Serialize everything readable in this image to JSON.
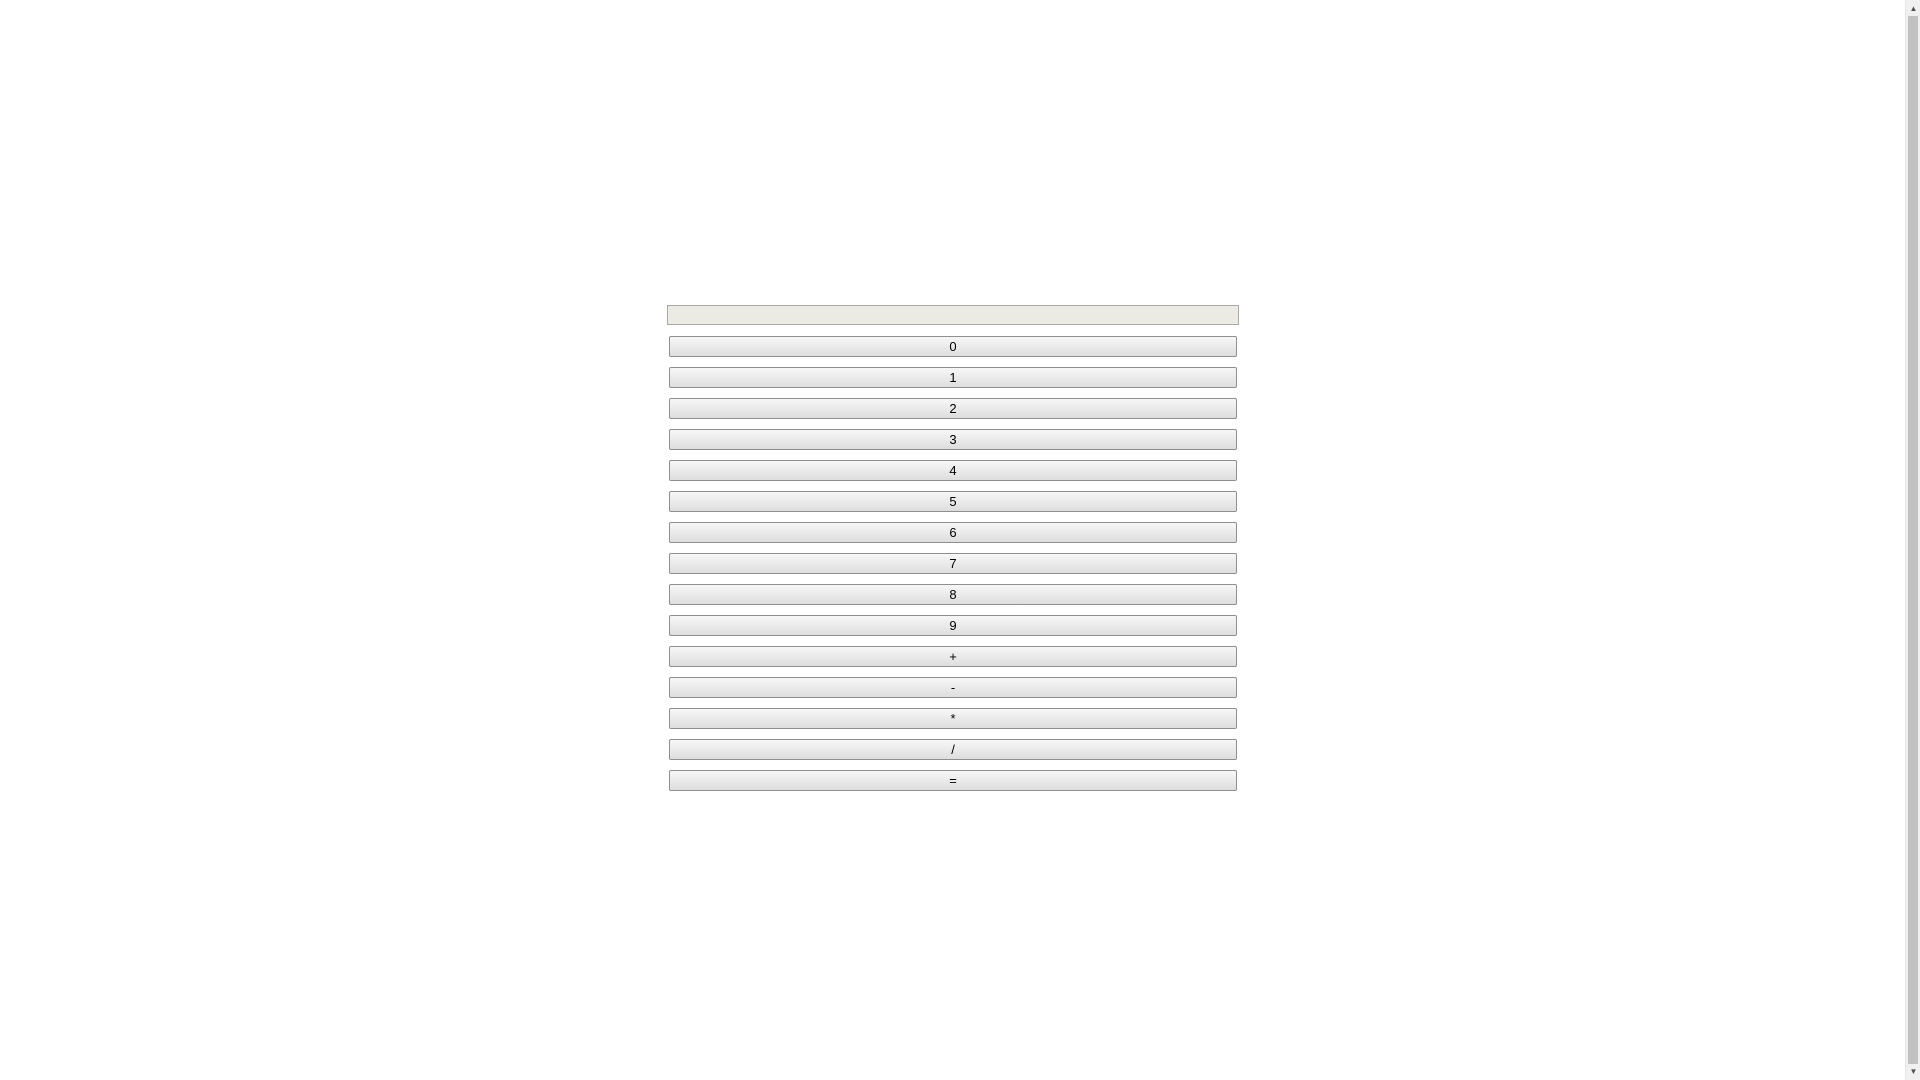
{
  "display": {
    "value": ""
  },
  "keys": [
    "0",
    "1",
    "2",
    "3",
    "4",
    "5",
    "6",
    "7",
    "8",
    "9",
    "+",
    "-",
    "*",
    "/",
    "="
  ],
  "scrollbar": {
    "up_icon": "chevron-up-icon",
    "down_icon": "chevron-down-icon"
  },
  "colors": {
    "display_bg": "#ebebe4",
    "button_border": "#8f8f8f"
  }
}
